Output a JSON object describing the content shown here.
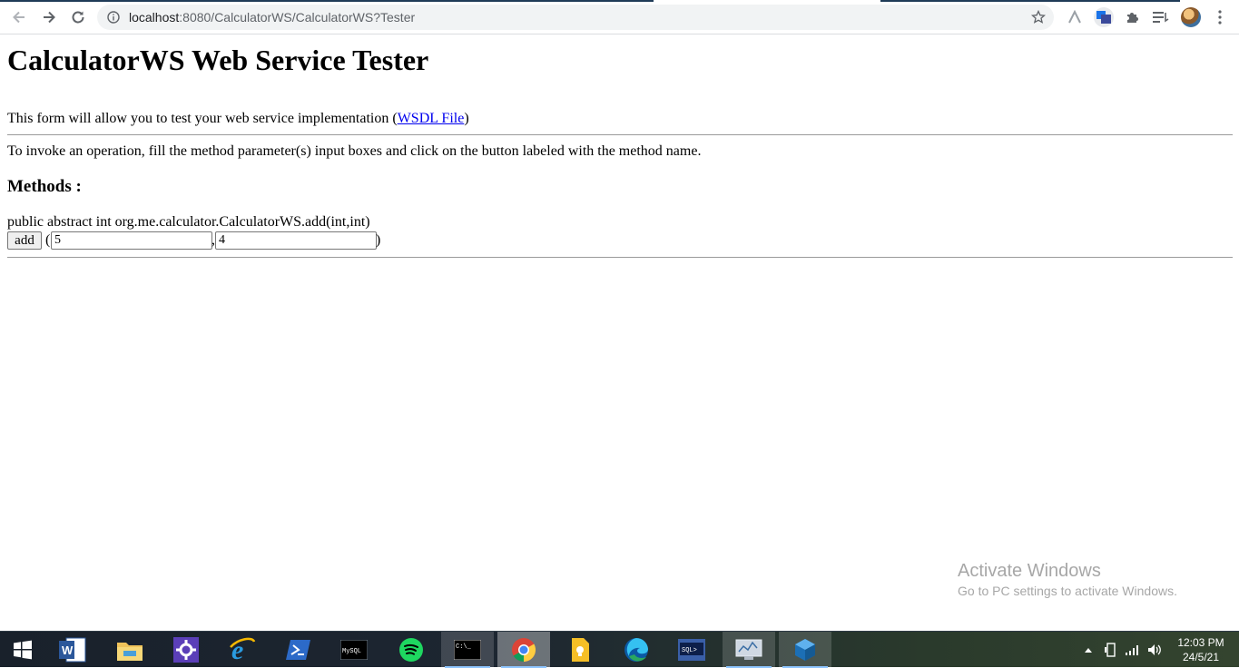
{
  "browser": {
    "url_host": "localhost",
    "url_rest": ":8080/CalculatorWS/CalculatorWS?Tester",
    "icons": [
      "back-arrow-icon",
      "forward-arrow-icon",
      "reload-icon",
      "info-icon",
      "star-icon",
      "extension-a-icon",
      "extension-translate-icon",
      "puzzle-icon",
      "reading-list-icon",
      "profile-avatar",
      "kebab-menu-icon"
    ]
  },
  "page": {
    "title": "CalculatorWS Web Service Tester",
    "intro_text": "This form will allow you to test your web service implementation (",
    "intro_link": "WSDL File",
    "intro_close": ")",
    "instructions": "To invoke an operation, fill the method parameter(s) input boxes and click on the button labeled with the method name.",
    "methods_heading": "Methods :",
    "method": {
      "signature": "public abstract int org.me.calculator.CalculatorWS.add(int,int)",
      "button_label": "add",
      "open_paren": "(",
      "separator": ",",
      "close_paren": ")",
      "param1_value": "5",
      "param2_value": "4"
    }
  },
  "watermark": {
    "title": "Activate Windows",
    "subtitle": "Go to PC settings to activate Windows."
  },
  "taskbar": {
    "apps": [
      "start-icon",
      "word-icon",
      "file-explorer-icon",
      "settings-icon",
      "internet-explorer-icon",
      "powershell-icon",
      "mysql-icon",
      "spotify-icon",
      "command-prompt-icon",
      "chrome-icon",
      "keep-icon",
      "edge-icon",
      "sql-plus-icon",
      "server-monitor-icon",
      "virtualbox-icon"
    ],
    "time": "12:03 PM",
    "date": "24/5/21"
  },
  "colors": {
    "link": "#0000ee",
    "rule": "#9a9a9a",
    "watermark": "#a7a7a7",
    "taskbar": "#1d2631"
  }
}
